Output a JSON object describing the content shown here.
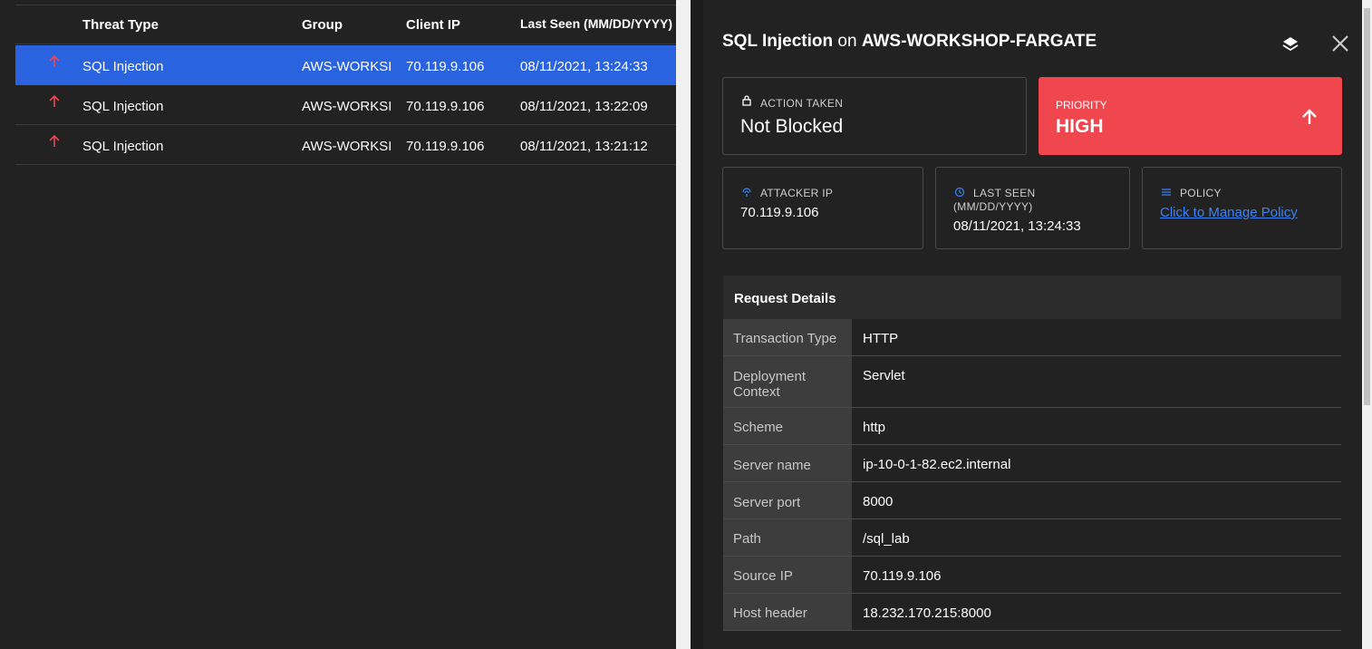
{
  "table": {
    "headers": [
      "Threat Type",
      "Group",
      "Client IP",
      "Last Seen (MM/DD/YYYY)"
    ],
    "rows": [
      {
        "threat": "SQL Injection",
        "group": "AWS-WORKSI",
        "ip": "70.119.9.106",
        "seen": "08/11/2021, 13:24:33"
      },
      {
        "threat": "SQL Injection",
        "group": "AWS-WORKSI",
        "ip": "70.119.9.106",
        "seen": "08/11/2021, 13:22:09"
      },
      {
        "threat": "SQL Injection",
        "group": "AWS-WORKSI",
        "ip": "70.119.9.106",
        "seen": "08/11/2021, 13:21:12"
      }
    ],
    "arrow_color": "#f0474f",
    "selected_color": "#2a63e0"
  },
  "panel": {
    "title_threat": "SQL Injection",
    "title_on": " on ",
    "title_app": "AWS-WORKSHOP-FARGATE",
    "action_label": "ACTION TAKEN",
    "action_value": "Not Blocked",
    "priority_label": "PRIORITY",
    "priority_value": "HIGH",
    "priority_color": "#f0474f",
    "attacker_label": "ATTACKER IP",
    "attacker_value": "70.119.9.106",
    "seen_label": "LAST SEEN",
    "seen_sub": "(MM/DD/YYYY)",
    "seen_value": "08/11/2021, 13:24:33",
    "policy_label": "POLICY",
    "policy_link": "Click to Manage Policy",
    "request_title": "Request Details",
    "details": [
      {
        "k": "Transaction Type",
        "v": "HTTP"
      },
      {
        "k": "Deployment Context",
        "v": "Servlet"
      },
      {
        "k": "Scheme",
        "v": "http"
      },
      {
        "k": "Server name",
        "v": "ip-10-0-1-82.ec2.internal"
      },
      {
        "k": "Server port",
        "v": "8000"
      },
      {
        "k": "Path",
        "v": "/sql_lab"
      },
      {
        "k": "Source IP",
        "v": "70.119.9.106"
      },
      {
        "k": "Host header",
        "v": "18.232.170.215:8000"
      }
    ]
  }
}
